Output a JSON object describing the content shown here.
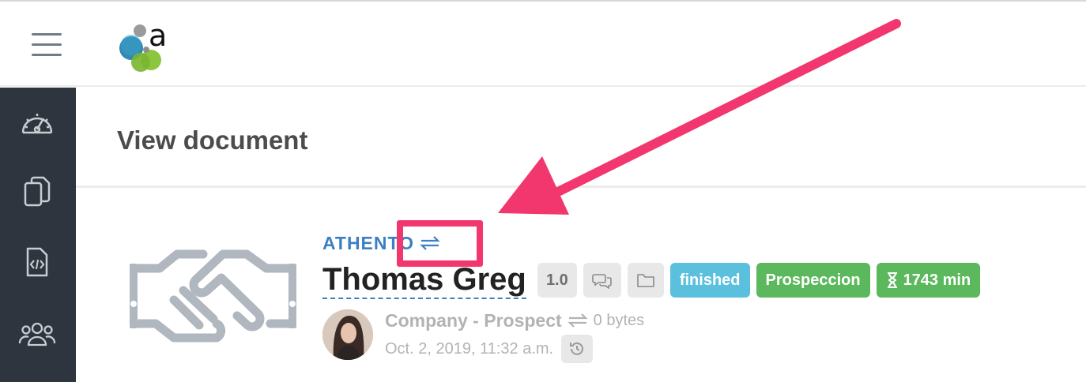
{
  "topbar": {
    "menu_icon": "hamburger-menu-icon",
    "logo": "athento-logo"
  },
  "sidebar": {
    "items": [
      {
        "icon": "dashboard-gauge-icon"
      },
      {
        "icon": "documents-copy-icon"
      },
      {
        "icon": "code-file-icon"
      },
      {
        "icon": "users-group-icon"
      }
    ]
  },
  "page": {
    "title": "View document"
  },
  "document": {
    "illustration": "handshake-icon",
    "provider": "ATHENTO",
    "provider_icon": "transfer-arrows-icon",
    "title": "Thomas Greg",
    "version": "1.0",
    "comments_icon": "comments-icon",
    "folder_icon": "folder-icon",
    "status": "finished",
    "stage": "Prospeccion",
    "timer_icon": "hourglass-icon",
    "duration": "1743 min",
    "type": "Company - Prospect",
    "type_icon": "transfer-arrows-icon",
    "size": "0 bytes",
    "date": "Oct. 2, 2019, 11:32 a.m.",
    "history_icon": "history-icon"
  },
  "annotation": {
    "color": "#f2376e"
  },
  "colors": {
    "sidebar": "#2f353e",
    "accent_blue": "#3b7fc4",
    "badge_blue": "#5bc0de",
    "badge_green": "#5cb85c"
  }
}
